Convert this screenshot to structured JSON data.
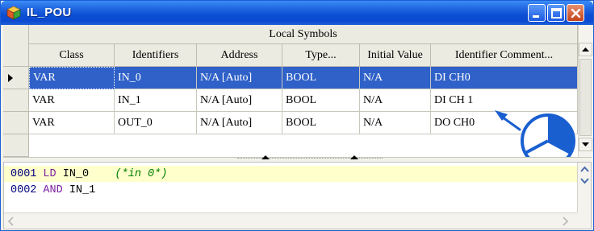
{
  "window": {
    "title": "IL_POU"
  },
  "grid": {
    "band_title": "Local Symbols",
    "columns": [
      "Class",
      "Identifiers",
      "Address",
      "Type...",
      "Initial Value",
      "Identifier Comment..."
    ],
    "rows": [
      {
        "class": "VAR",
        "identifier": "IN_0",
        "address": "N/A [Auto]",
        "type": "BOOL",
        "initial_value": "N/A",
        "comment": "DI CH0",
        "selected": true
      },
      {
        "class": "VAR",
        "identifier": "IN_1",
        "address": "N/A [Auto]",
        "type": "BOOL",
        "initial_value": "N/A",
        "comment": "DI CH 1",
        "selected": false
      },
      {
        "class": "VAR",
        "identifier": "OUT_0",
        "address": "N/A [Auto]",
        "type": "BOOL",
        "initial_value": "N/A",
        "comment": "DO CH0",
        "selected": false
      }
    ]
  },
  "editor": {
    "lines": [
      {
        "number": "0001",
        "op": "LD",
        "operand": "IN_0",
        "comment": "(*in 0*)"
      },
      {
        "number": "0002",
        "op": "AND",
        "operand": "IN_1",
        "comment": ""
      }
    ]
  },
  "colors": {
    "selection": "#2f61c8",
    "titlebar": "#0b4fd4",
    "current_line": "#ffffcc",
    "annotation": "#1a5fd0"
  }
}
